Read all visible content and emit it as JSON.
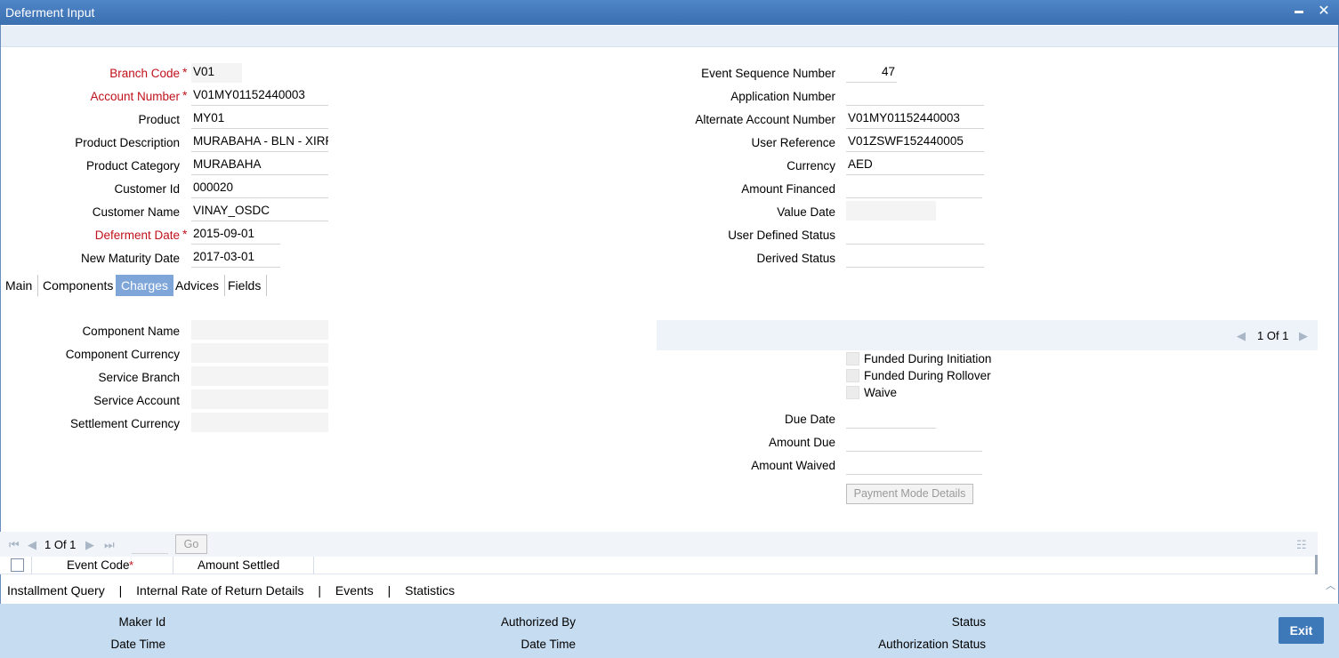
{
  "window": {
    "title": "Deferment Input",
    "minimize_glyph": "▬",
    "close_glyph": "✕"
  },
  "header_left": [
    {
      "label": "Branch Code",
      "value": "V01",
      "required": true
    },
    {
      "label": "Account Number",
      "value": "V01MY01152440003",
      "required": true
    },
    {
      "label": "Product",
      "value": "MY01",
      "required": false
    },
    {
      "label": "Product Description",
      "value": "MURABAHA - BLN - XIRR",
      "required": false
    },
    {
      "label": "Product Category",
      "value": "MURABAHA",
      "required": false
    },
    {
      "label": "Customer Id",
      "value": "000020",
      "required": false
    },
    {
      "label": "Customer Name",
      "value": "VINAY_OSDC",
      "required": false
    },
    {
      "label": "Deferment Date",
      "value": "2015-09-01",
      "required": true
    },
    {
      "label": "New Maturity Date",
      "value": "2017-03-01",
      "required": false
    }
  ],
  "header_right": [
    {
      "label": "Event Sequence Number",
      "value": "47"
    },
    {
      "label": "Application Number",
      "value": ""
    },
    {
      "label": "Alternate Account Number",
      "value": "V01MY01152440003"
    },
    {
      "label": "User Reference",
      "value": "V01ZSWF152440005"
    },
    {
      "label": "Currency",
      "value": "AED"
    },
    {
      "label": "Amount Financed",
      "value": ""
    },
    {
      "label": "Value Date",
      "value": ""
    },
    {
      "label": "User Defined Status",
      "value": ""
    },
    {
      "label": "Derived Status",
      "value": ""
    }
  ],
  "required_mark": "*",
  "tabs": [
    "Main",
    "Components",
    "Charges",
    "Advices",
    "Fields"
  ],
  "active_tab": "Charges",
  "charges_left": [
    {
      "label": "Component Name",
      "value": ""
    },
    {
      "label": "Component Currency",
      "value": ""
    },
    {
      "label": "Service Branch",
      "value": ""
    },
    {
      "label": "Service Account",
      "value": ""
    },
    {
      "label": "Settlement Currency",
      "value": ""
    }
  ],
  "charges_pager": {
    "text": "1 Of 1"
  },
  "charges_checks": [
    {
      "label": "Funded During Initiation",
      "checked": false
    },
    {
      "label": "Funded During Rollover",
      "checked": false
    },
    {
      "label": "Waive",
      "checked": false
    }
  ],
  "charges_right": [
    {
      "label": "Due Date",
      "value": ""
    },
    {
      "label": "Amount Due",
      "value": ""
    },
    {
      "label": "Amount Waived",
      "value": ""
    }
  ],
  "payment_mode_button": "Payment Mode Details",
  "grid": {
    "pager_text": "1 Of 1",
    "go_label": "Go",
    "columns": [
      {
        "label": "Event Code",
        "required": true
      },
      {
        "label": "Amount Settled",
        "required": false
      }
    ]
  },
  "bottom_links": [
    "Installment Query",
    "Internal Rate of Return Details",
    "Events",
    "Statistics"
  ],
  "link_separator": "|",
  "footer": {
    "maker_id": "Maker Id",
    "date_time": "Date Time",
    "authorized_by": "Authorized By",
    "date_time_2": "Date Time",
    "status": "Status",
    "authorization_status": "Authorization Status",
    "exit_label": "Exit"
  },
  "colors": {
    "title_bar": "#3a6fb0",
    "active_tab": "#7ea6d9",
    "footer": "#c6dcf0",
    "exit_button": "#3d78b9",
    "required": "#c0111b"
  }
}
